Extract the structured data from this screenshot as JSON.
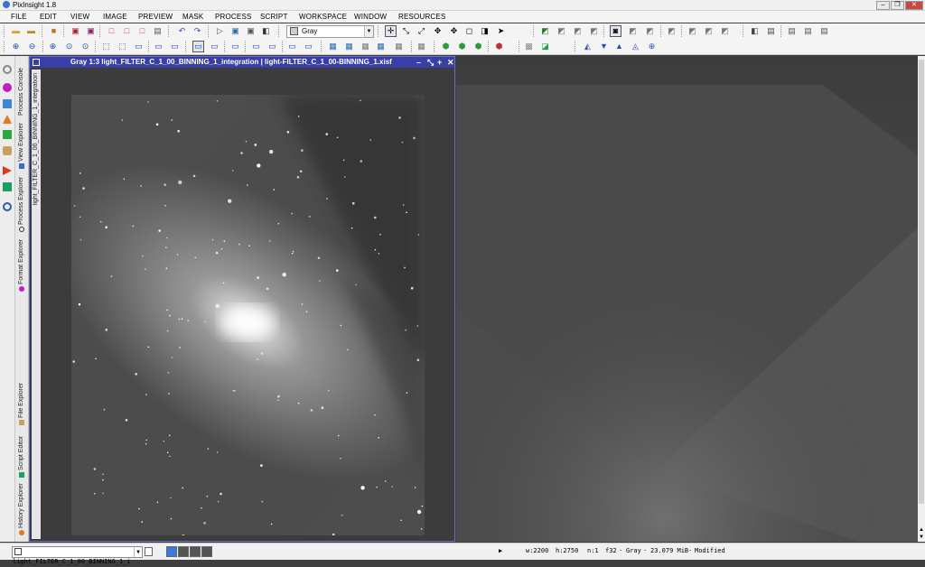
{
  "window": {
    "title": "PixInsight 1.8"
  },
  "menu": [
    "FILE",
    "EDIT",
    "VIEW",
    "IMAGE",
    "PREVIEW",
    "MASK",
    "PROCESS",
    "SCRIPT",
    "WORKSPACE",
    "WINDOW",
    "RESOURCES"
  ],
  "toolbar": {
    "color_space_value": "Gray"
  },
  "explorer_tabs": [
    "Process Console",
    "View Explorer",
    "Process Explorer",
    "Format Explorer",
    "File Explorer",
    "Script Editor",
    "History Explorer"
  ],
  "image_window": {
    "title": "Gray 1:3 light_FILTER_C_1_00_BINNING_1_integration | light-FILTER_C_1_00-BINNING_1.xisf",
    "identifier": "light_FILTER_C_1_00_BINNING_1_integration"
  },
  "status": {
    "view_selector": "light_FILTER_C_1_00_BINNING_1_i",
    "width": "w:2200",
    "height": "h:2750",
    "channels": "n:1",
    "format": "f32",
    "color": "Gray",
    "size": "23.079 MiB",
    "state": "Modified"
  }
}
